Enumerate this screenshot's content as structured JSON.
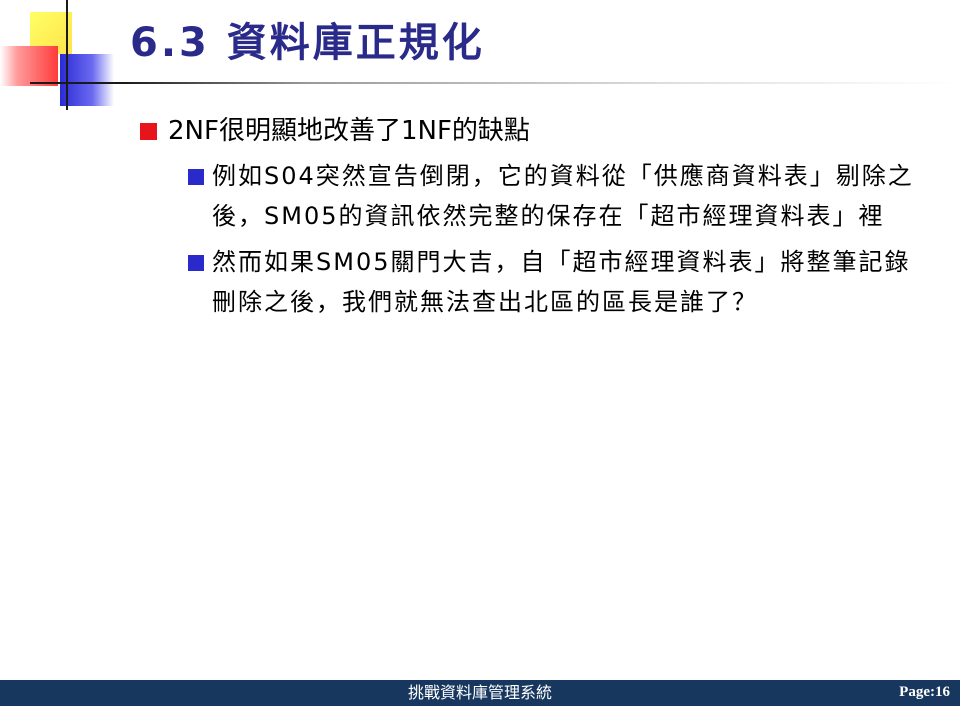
{
  "slide": {
    "title": "6.3 資料庫正規化",
    "bullets": [
      {
        "text": "2NF很明顯地改善了1NF的缺點",
        "children": [
          {
            "text": "例如S04突然宣告倒閉，它的資料從「供應商資料表」剔除之後，SM05的資訊依然完整的保存在「超市經理資料表」裡"
          },
          {
            "text": "然而如果SM05關門大吉，自「超市經理資料表」將整筆記錄刪除之後，我們就無法查出北區的區長是誰了？"
          }
        ]
      }
    ]
  },
  "footer": {
    "title": "挑戰資料庫管理系統",
    "page": "Page:16"
  },
  "colors": {
    "title": "#2a2a8a",
    "bullet_level1": "#e8141b",
    "bullet_level2": "#2a2acc",
    "footer_bg": "#17375e"
  }
}
